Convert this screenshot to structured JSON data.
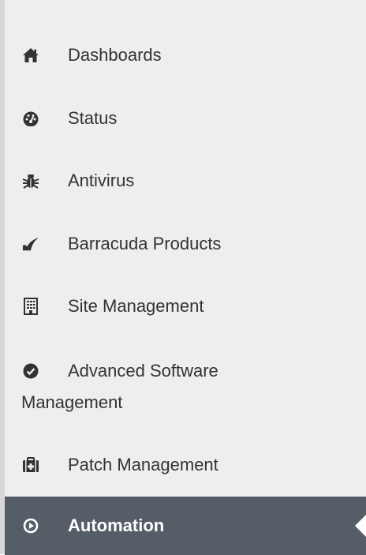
{
  "sidebar": {
    "items": [
      {
        "label": "Dashboards",
        "icon": "home-icon"
      },
      {
        "label": "Status",
        "icon": "dashboard-gauge-icon"
      },
      {
        "label": "Antivirus",
        "icon": "bug-icon"
      },
      {
        "label": "Barracuda Products",
        "icon": "barracuda-logo-icon"
      },
      {
        "label": "Site Management",
        "icon": "building-icon"
      },
      {
        "label_line1": "Advanced Software",
        "label_line2": "Management",
        "icon": "check-circle-icon"
      },
      {
        "label": "Patch Management",
        "icon": "medkit-icon"
      },
      {
        "label": "Automation",
        "icon": "play-circle-icon",
        "active": true
      }
    ]
  },
  "colors": {
    "sidebar_bg": "#eeeeee",
    "text": "#333333",
    "active_bg": "#555d66",
    "active_text": "#ffffff"
  }
}
